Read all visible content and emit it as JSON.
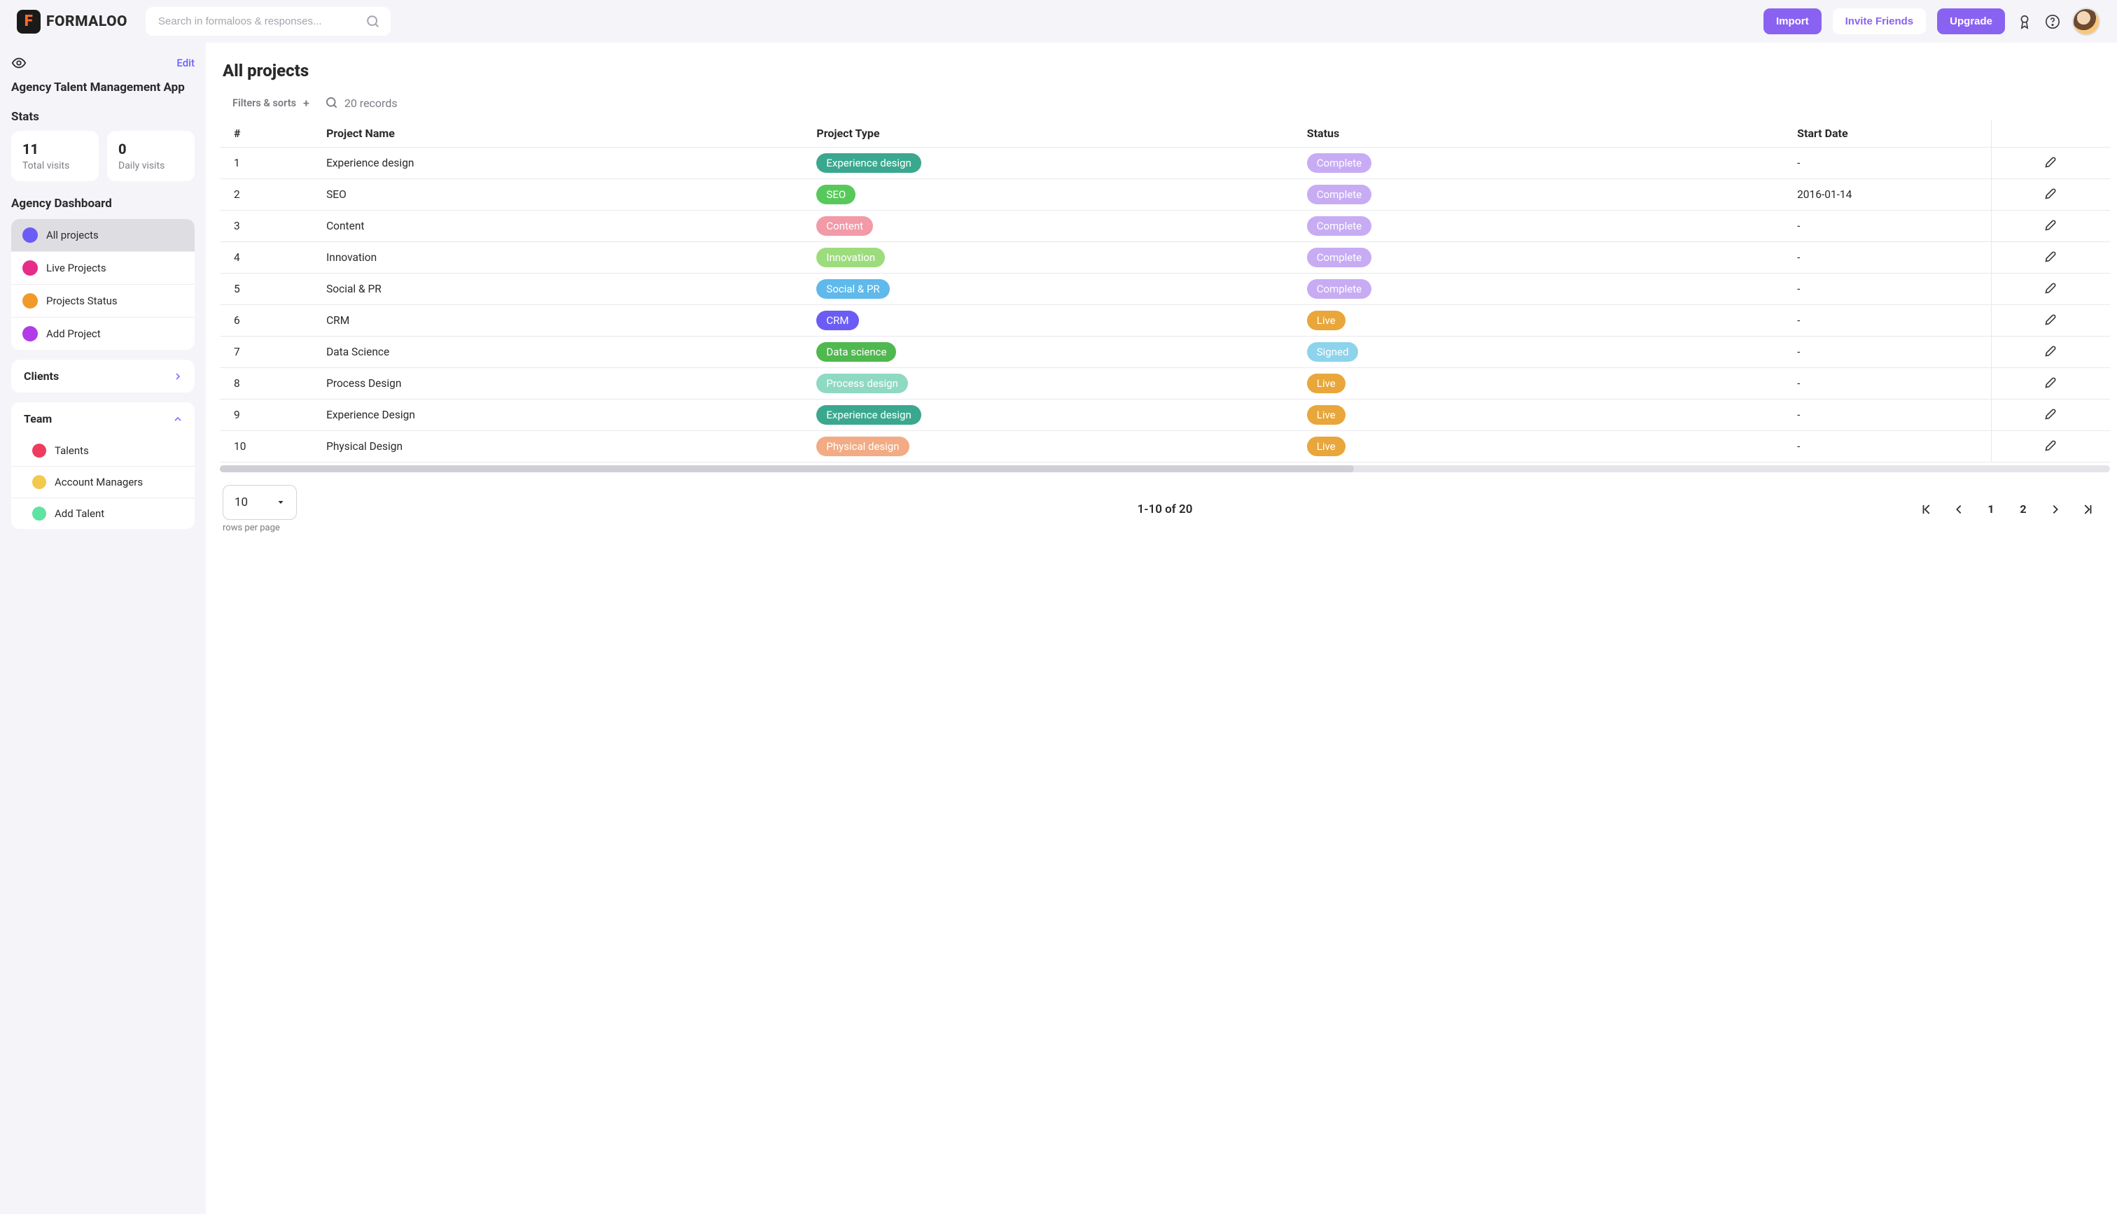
{
  "header": {
    "brand": "FORMALOO",
    "search_placeholder": "Search in formaloos & responses...",
    "import_label": "Import",
    "invite_label": "Invite Friends",
    "upgrade_label": "Upgrade"
  },
  "sidebar": {
    "edit_label": "Edit",
    "app_title": "Agency Talent Management App",
    "stats_heading": "Stats",
    "stats": [
      {
        "value": "11",
        "label": "Total visits"
      },
      {
        "value": "0",
        "label": "Daily visits"
      }
    ],
    "dashboard_heading": "Agency Dashboard",
    "nav_items": [
      {
        "label": "All projects",
        "color": "#6b5cf6",
        "active": true
      },
      {
        "label": "Live Projects",
        "color": "#e82c8a",
        "active": false
      },
      {
        "label": "Projects Status",
        "color": "#f09a2a",
        "active": false
      },
      {
        "label": "Add Project",
        "color": "#b23be8",
        "active": false
      }
    ],
    "groups": [
      {
        "label": "Clients",
        "expanded": false
      },
      {
        "label": "Team",
        "expanded": true,
        "items": [
          {
            "label": "Talents",
            "color": "#ef3b5e"
          },
          {
            "label": "Account Managers",
            "color": "#f2c94c"
          },
          {
            "label": "Add Talent",
            "color": "#5fe3a1"
          }
        ]
      }
    ]
  },
  "main": {
    "title": "All projects",
    "filters_label": "Filters & sorts",
    "records_label": "20 records",
    "columns": [
      "#",
      "Project Name",
      "Project Type",
      "Status",
      "Start Date"
    ],
    "rows": [
      {
        "n": "1",
        "name": "Experience design",
        "type": {
          "label": "Experience design",
          "bg": "#3aa88e"
        },
        "status": {
          "label": "Complete",
          "bg": "#c7acf4"
        },
        "date": "-"
      },
      {
        "n": "2",
        "name": "SEO",
        "type": {
          "label": "SEO",
          "bg": "#57c95a"
        },
        "status": {
          "label": "Complete",
          "bg": "#c7acf4"
        },
        "date": "2016-01-14"
      },
      {
        "n": "3",
        "name": "Content",
        "type": {
          "label": "Content",
          "bg": "#f29aa7"
        },
        "status": {
          "label": "Complete",
          "bg": "#c7acf4"
        },
        "date": "-"
      },
      {
        "n": "4",
        "name": "Innovation",
        "type": {
          "label": "Innovation",
          "bg": "#9ddc7d"
        },
        "status": {
          "label": "Complete",
          "bg": "#c7acf4"
        },
        "date": "-"
      },
      {
        "n": "5",
        "name": "Social & PR",
        "type": {
          "label": "Social & PR",
          "bg": "#5fb9ea"
        },
        "status": {
          "label": "Complete",
          "bg": "#c7acf4"
        },
        "date": "-"
      },
      {
        "n": "6",
        "name": "CRM",
        "type": {
          "label": "CRM",
          "bg": "#6b5cf6"
        },
        "status": {
          "label": "Live",
          "bg": "#e9a63a"
        },
        "date": "-"
      },
      {
        "n": "7",
        "name": "Data Science",
        "type": {
          "label": "Data science",
          "bg": "#4fb84f"
        },
        "status": {
          "label": "Signed",
          "bg": "#8dd3ec"
        },
        "date": "-"
      },
      {
        "n": "8",
        "name": "Process Design",
        "type": {
          "label": "Process design",
          "bg": "#8fd9c2"
        },
        "status": {
          "label": "Live",
          "bg": "#e9a63a"
        },
        "date": "-"
      },
      {
        "n": "9",
        "name": "Experience Design",
        "type": {
          "label": "Experience design",
          "bg": "#3aa88e"
        },
        "status": {
          "label": "Live",
          "bg": "#e9a63a"
        },
        "date": "-"
      },
      {
        "n": "10",
        "name": "Physical Design",
        "type": {
          "label": "Physical design",
          "bg": "#f2ab84"
        },
        "status": {
          "label": "Live",
          "bg": "#e9a63a"
        },
        "date": "-"
      }
    ],
    "page_size": "10",
    "page_size_label": "rows per page",
    "range_label": "1-10 of 20",
    "pages": [
      "1",
      "2"
    ]
  }
}
